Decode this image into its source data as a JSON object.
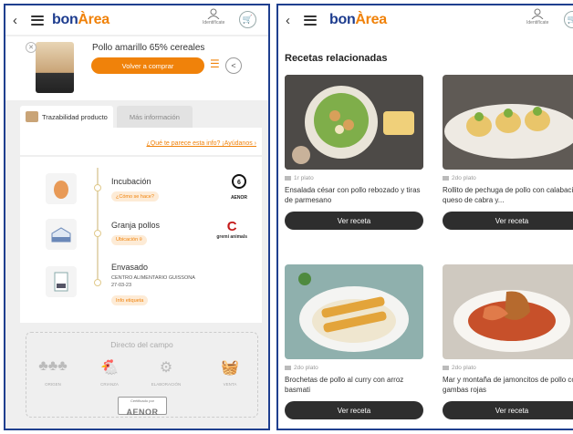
{
  "header": {
    "back_glyph": "‹",
    "logo_part1": "bon",
    "logo_part2": "Àrea",
    "user_label": "Identifícate"
  },
  "product": {
    "name": "Pollo amarillo 65% cereales",
    "buy_again": "Volver a comprar"
  },
  "tabs": [
    {
      "label": "Trazabilidad producto",
      "active": true
    },
    {
      "label": "Más información",
      "active": false
    }
  ],
  "feedback_link": "¿Qué te parece esta info? ¡Ayúdanos ›",
  "trace_steps": [
    {
      "title": "Incubación",
      "pill": "¿Cómo se hace?",
      "icon": "egg-icon"
    },
    {
      "title": "Granja pollos",
      "pill": "Ubicación ⌾",
      "icon": "farm-icon"
    },
    {
      "title": "Envasado",
      "sub1": "CENTRO ALIMENTARIO GUISSONA",
      "sub2": "27-03-23",
      "pill": "Info etiqueta",
      "icon": "package-icon"
    }
  ],
  "seals": {
    "aenor_small": "AENOR",
    "second_small": "gremi animals"
  },
  "campo": {
    "title": "Directo del campo",
    "items": [
      "ORIGEN",
      "CRIANZA",
      "ELABORACIÓN",
      "VENTA"
    ],
    "badge_small": "Certificado por",
    "badge_main": "AENOR"
  },
  "related": {
    "title": "Recetas relacionadas",
    "recipes": [
      {
        "course": "1r plato",
        "name": "Ensalada césar con pollo rebozado y tiras de parmesano",
        "button": "Ver receta"
      },
      {
        "course": "2do plato",
        "name": "Rollito de pechuga de pollo con calabacín, queso de cabra y...",
        "button": "Ver receta"
      },
      {
        "course": "2do plato",
        "name": "Brochetas de pollo al curry con arroz basmati",
        "button": "Ver receta"
      },
      {
        "course": "2do plato",
        "name": "Mar y montaña de jamoncitos de pollo con gambas rojas",
        "button": "Ver receta"
      }
    ]
  },
  "colors": {
    "brand_blue": "#1d3c8e",
    "brand_orange": "#f0820a"
  }
}
